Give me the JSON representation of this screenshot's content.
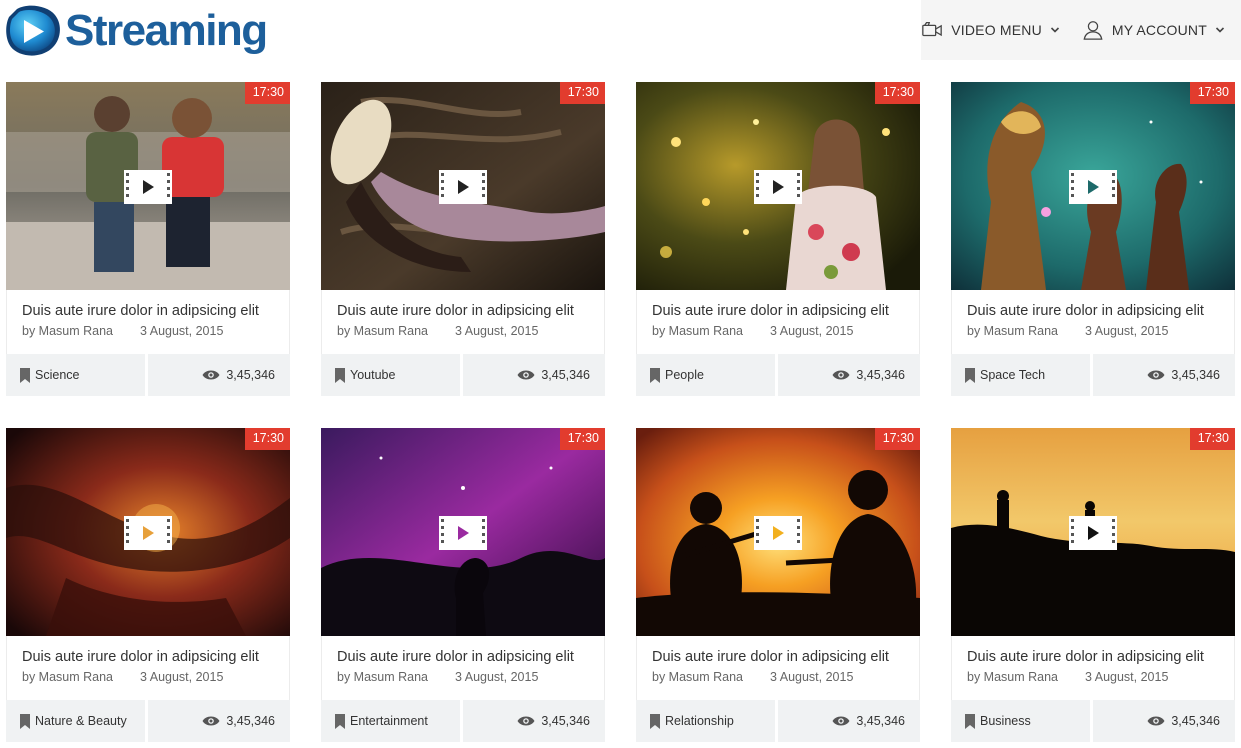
{
  "brand": {
    "name": "Streaming",
    "accent": "#1d5f9b",
    "duration_badge_color": "#e23c2e"
  },
  "nav": {
    "video_menu": {
      "label": "VIDEO MENU",
      "icon": "video-camera-icon"
    },
    "my_account": {
      "label": "MY ACCOUNT",
      "icon": "user-icon"
    }
  },
  "videos": [
    {
      "duration": "17:30",
      "title": "Duis aute irure dolor in adipsicing elit",
      "author": "by Masum Rana",
      "date": "3 August, 2015",
      "category": "Science",
      "views": "3,45,346"
    },
    {
      "duration": "17:30",
      "title": "Duis aute irure dolor in adipsicing elit",
      "author": "by Masum Rana",
      "date": "3 August, 2015",
      "category": "Youtube",
      "views": "3,45,346"
    },
    {
      "duration": "17:30",
      "title": "Duis aute irure dolor in adipsicing elit",
      "author": "by Masum Rana",
      "date": "3 August, 2015",
      "category": "People",
      "views": "3,45,346"
    },
    {
      "duration": "17:30",
      "title": "Duis aute irure dolor in adipsicing elit",
      "author": "by Masum Rana",
      "date": "3 August, 2015",
      "category": "Space Tech",
      "views": "3,45,346"
    },
    {
      "duration": "17:30",
      "title": "Duis aute irure dolor in adipsicing elit",
      "author": "by Masum Rana",
      "date": "3 August, 2015",
      "category": "Nature & Beauty",
      "views": "3,45,346"
    },
    {
      "duration": "17:30",
      "title": "Duis aute irure dolor in adipsicing elit",
      "author": "by Masum Rana",
      "date": "3 August, 2015",
      "category": "Entertainment",
      "views": "3,45,346"
    },
    {
      "duration": "17:30",
      "title": "Duis aute irure dolor in adipsicing elit",
      "author": "by Masum Rana",
      "date": "3 August, 2015",
      "category": "Relationship",
      "views": "3,45,346"
    },
    {
      "duration": "17:30",
      "title": "Duis aute irure dolor in adipsicing elit",
      "author": "by Masum Rana",
      "date": "3 August, 2015",
      "category": "Business",
      "views": "3,45,346"
    }
  ]
}
